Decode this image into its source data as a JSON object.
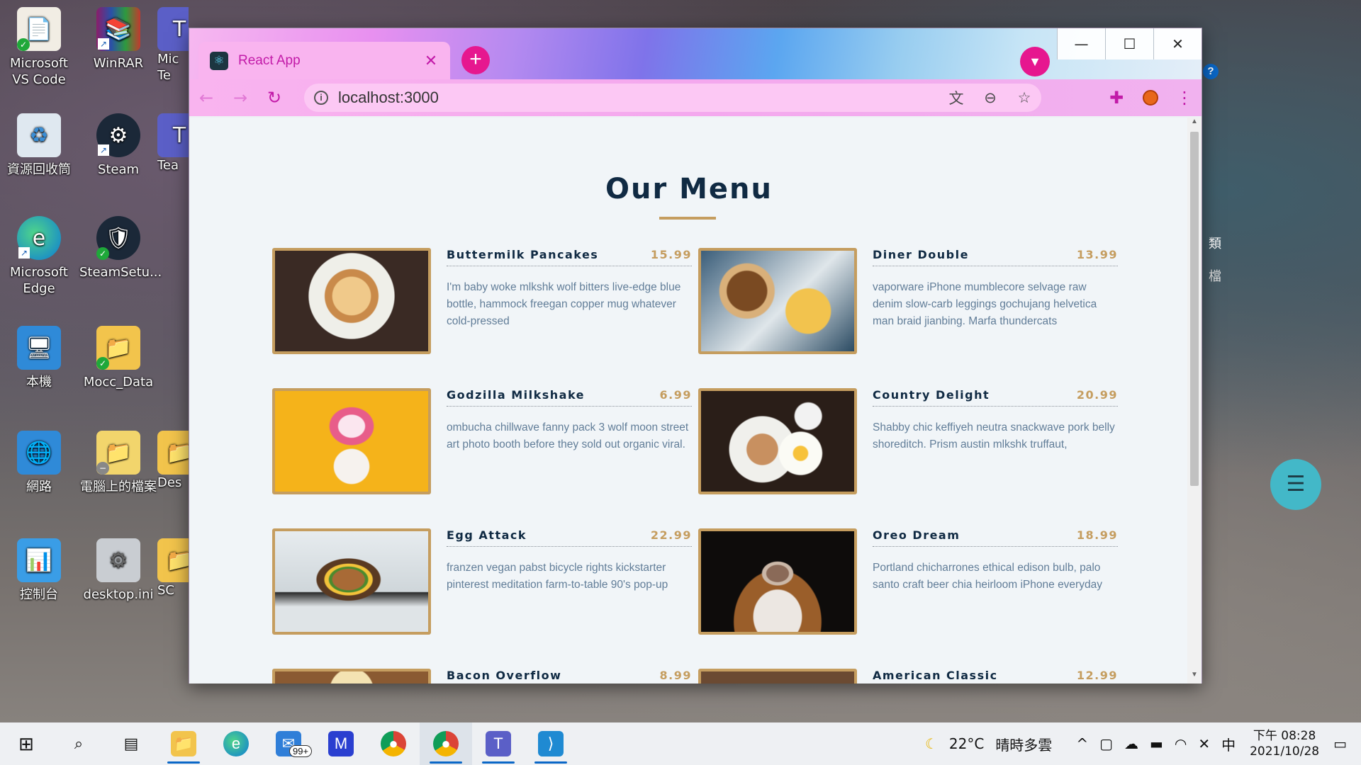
{
  "desktop": {
    "icons": [
      {
        "label": "Microsoft VS Code"
      },
      {
        "label": "WinRAR"
      },
      {
        "label": "資源回收筒"
      },
      {
        "label": "Steam"
      },
      {
        "label": "Microsoft Edge"
      },
      {
        "label": "SteamSetu..."
      },
      {
        "label": "本機"
      },
      {
        "label": "Mocc_Data"
      },
      {
        "label": "網路"
      },
      {
        "label": "電腦上的檔案"
      },
      {
        "label": "控制台"
      },
      {
        "label": "desktop.ini"
      }
    ],
    "partial_labels": [
      "Mic Te",
      "Tea",
      "Des",
      "SC"
    ],
    "background_text": {
      "right_a": "類",
      "right_b": "檔"
    }
  },
  "browser": {
    "tab_title": "React App",
    "url": "localhost:3000",
    "window_controls": {
      "minimize": "—",
      "maximize": "☐",
      "close": "✕"
    }
  },
  "page": {
    "title": "Our Menu",
    "items": [
      {
        "name": "Buttermilk Pancakes",
        "price": "15.99",
        "desc": "I'm baby woke mlkshk wolf bitters live-edge blue bottle, hammock freegan copper mug whatever cold-pressed"
      },
      {
        "name": "Diner Double",
        "price": "13.99",
        "desc": "vaporware iPhone mumblecore selvage raw denim slow-carb leggings gochujang helvetica man braid jianbing. Marfa thundercats"
      },
      {
        "name": "Godzilla Milkshake",
        "price": "6.99",
        "desc": "ombucha chillwave fanny pack 3 wolf moon street art photo booth before they sold out organic viral."
      },
      {
        "name": "Country Delight",
        "price": "20.99",
        "desc": "Shabby chic keffiyeh neutra snackwave pork belly shoreditch. Prism austin mlkshk truffaut,"
      },
      {
        "name": "Egg Attack",
        "price": "22.99",
        "desc": "franzen vegan pabst bicycle rights kickstarter pinterest meditation farm-to-table 90's pop-up"
      },
      {
        "name": "Oreo Dream",
        "price": "18.99",
        "desc": "Portland chicharrones ethical edison bulb, palo santo craft beer chia heirloom iPhone everyday"
      },
      {
        "name": "Bacon Overflow",
        "price": "8.99",
        "desc": ""
      },
      {
        "name": "American Classic",
        "price": "12.99",
        "desc": ""
      }
    ]
  },
  "taskbar": {
    "mail_badge": "99+",
    "weather_temp": "22°C",
    "weather_text": "晴時多雲",
    "ime": "中",
    "time": "下午 08:28",
    "date": "2021/10/28"
  },
  "colors": {
    "accent_gold": "#c59d5f",
    "title_navy": "#102a43",
    "desc_gray": "#617d98",
    "tab_pink": "#f9b4ef",
    "tab_text": "#c21aa8",
    "taskbar_active": "#0a67c7"
  }
}
